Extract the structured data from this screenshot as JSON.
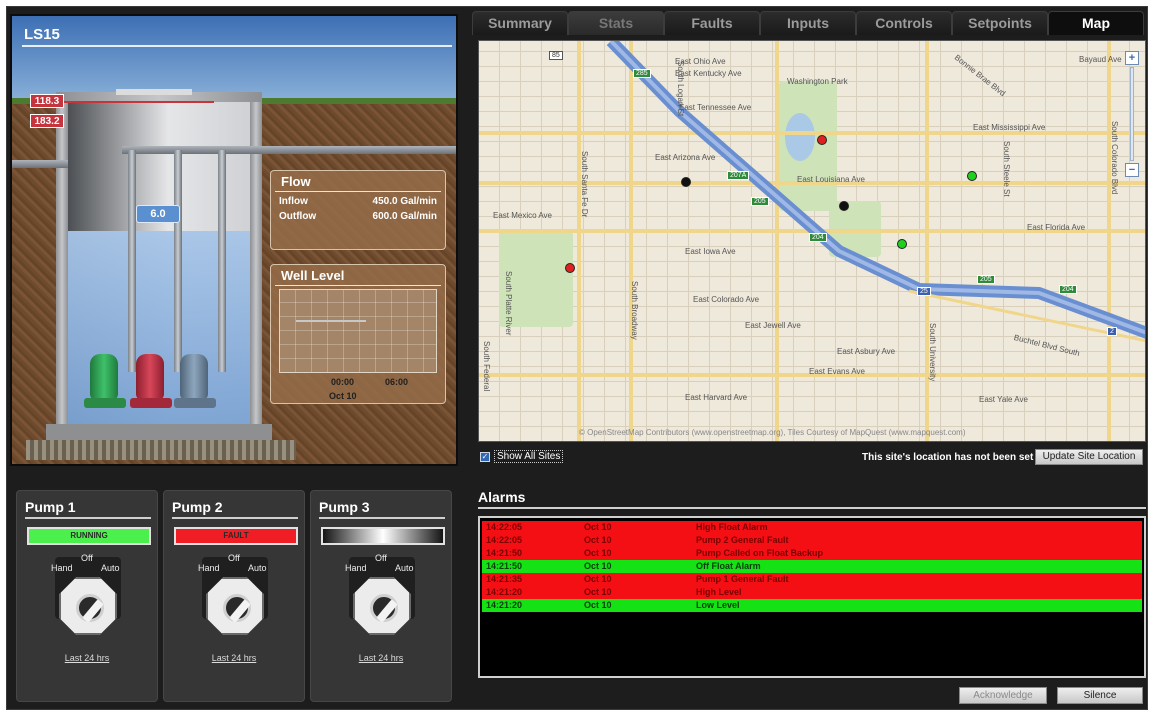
{
  "site": {
    "title": "LS15",
    "high_level_1": "118.3",
    "high_level_2": "183.2",
    "water_level": "6.0"
  },
  "flow": {
    "title": "Flow",
    "inflow_label": "Inflow",
    "inflow_value": "450.0 Gal/min",
    "outflow_label": "Outflow",
    "outflow_value": "600.0 Gal/min"
  },
  "wet_well": {
    "title": "Well Level",
    "tick_1": "00:00",
    "tick_2": "06:00",
    "date": "Oct 10"
  },
  "pumps": [
    {
      "title": "Pump 1",
      "status": "RUNNING",
      "status_color": "#4cf04c",
      "hand": "Hand",
      "off": "Off",
      "auto": "Auto",
      "link": "Last 24 hrs"
    },
    {
      "title": "Pump 2",
      "status": "FAULT",
      "status_color": "#f01e24",
      "hand": "Hand",
      "off": "Off",
      "auto": "Auto",
      "link": "Last 24 hrs"
    },
    {
      "title": "Pump 3",
      "status": "",
      "status_color": "#141414",
      "hand": "Hand",
      "off": "Off",
      "auto": "Auto",
      "link": "Last 24 hrs"
    }
  ],
  "tabs": [
    {
      "label": "Summary"
    },
    {
      "label": "Stats"
    },
    {
      "label": "Faults"
    },
    {
      "label": "Inputs"
    },
    {
      "label": "Controls"
    },
    {
      "label": "Setpoints"
    },
    {
      "label": "Map"
    }
  ],
  "active_tab": "Map",
  "map": {
    "streets": {
      "mississippi": "East Mississippi Ave",
      "louisiana": "East Louisiana Ave",
      "florida": "East Florida Ave",
      "evans": "East Evans Ave",
      "arizona": "East Arizona Ave",
      "iowa": "East Iowa Ave",
      "colorado": "East Colorado Ave",
      "jewell": "East Jewell Ave",
      "asbury": "East Asbury Ave",
      "buchtel": "Buchtel Blvd South",
      "washington_park": "Washington Park",
      "bonnie_brae": "Bonnie Brae Blvd",
      "south_broadway": "South Broadway",
      "south_logan": "South Logan St",
      "south_university": "South University",
      "south_colorado": "South Colorado Blvd",
      "south_santa_fe": "South Santa Fe Dr",
      "south_platte": "South Platte River",
      "south_steele": "South Steele St",
      "south_federal": "South Federal",
      "bayaud": "Bayaud Ave",
      "east_kentucky": "East Kentucky Ave",
      "east_tennessee": "East Tennessee Ave",
      "east_ohio": "East Ohio Ave",
      "east_mexico": "East Mexico Ave",
      "east_yale": "East Yale Ave",
      "east_harvard": "East Harvard Ave"
    },
    "shields": [
      "85",
      "285",
      "207A",
      "205",
      "204",
      "25",
      "205",
      "204",
      "2"
    ],
    "attribution": "© OpenStreetMap Contributors (www.openstreetmap.org), Tiles Courtesy of MapQuest (www.mapquest.com)",
    "zoom_in": "+",
    "zoom_out": "−"
  },
  "controls": {
    "show_all_label": "Show All Sites",
    "show_all_checked": true,
    "location_message": "This site's location has not been set",
    "update_location_button": "Update Site Location"
  },
  "alarms": {
    "title": "Alarms",
    "rows": [
      {
        "time": "14:22:05",
        "date": "Oct 10",
        "message": "High Float Alarm",
        "severity": "red"
      },
      {
        "time": "14:22:05",
        "date": "Oct 10",
        "message": "Pump 2 General Fault",
        "severity": "red"
      },
      {
        "time": "14:21:50",
        "date": "Oct 10",
        "message": "Pump Called on Float Backup",
        "severity": "red"
      },
      {
        "time": "14:21:50",
        "date": "Oct 10",
        "message": "Off Float Alarm",
        "severity": "green"
      },
      {
        "time": "14:21:35",
        "date": "Oct 10",
        "message": "Pump 1 General Fault",
        "severity": "red"
      },
      {
        "time": "14:21:20",
        "date": "Oct 10",
        "message": "High Level",
        "severity": "red"
      },
      {
        "time": "14:21:20",
        "date": "Oct 10",
        "message": "Low Level",
        "severity": "green"
      }
    ],
    "acknowledge_button": "Acknowledge",
    "silence_button": "Silence"
  }
}
